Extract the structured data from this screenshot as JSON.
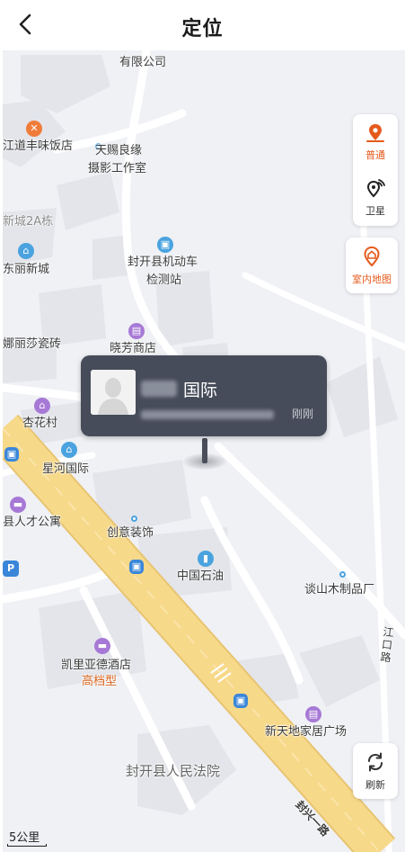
{
  "header": {
    "title": "定位"
  },
  "controls": {
    "normal": "普通",
    "satellite": "卫星",
    "indoor": "室内地图",
    "refresh": "刷新"
  },
  "popup": {
    "name_suffix": "国际",
    "time": "刚刚"
  },
  "scale": "5公里",
  "labels": {
    "company": "有限公司",
    "restaurant": "江道丰味饭店",
    "photo_line1": "天赐良缘",
    "photo_line2": "摄影工作室",
    "xincheng": "新城2A栋",
    "dongli": "东丽新城",
    "vehicle_line1": "封开县机动车",
    "vehicle_line2": "检测站",
    "tiles": "娜丽莎瓷砖",
    "xiaofang": "晓芳商店",
    "xinghua": "杏花村",
    "xinghe": "星河国际",
    "talent": "县人才公寓",
    "decor": "创意装饰",
    "sinopec": "中国石油",
    "wood": "谈山木制品厂",
    "hotel": "凯里亚德酒店",
    "hotel_tag": "高档型",
    "furniture": "新天地家居广场",
    "court": "封开县人民法院",
    "road_side": "江口路",
    "road_main": "封兴一路"
  },
  "colors": {
    "accent": "#e55a1c",
    "popup_bg": "#474c5a",
    "road_yellow": "#f7d98a"
  }
}
